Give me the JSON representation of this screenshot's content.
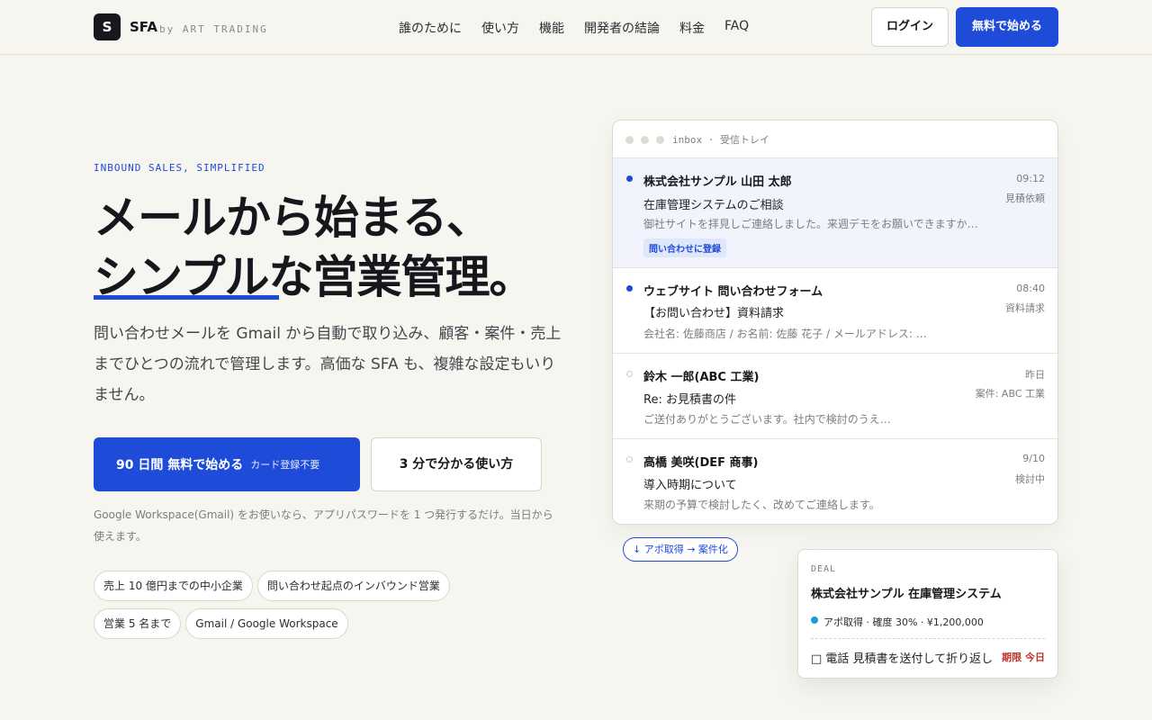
{
  "header": {
    "logo_letter": "S",
    "brand": "SFA",
    "brand_by": "by ART TRADING",
    "nav": [
      "誰のために",
      "使い方",
      "機能",
      "開発者の結論",
      "料金",
      "FAQ"
    ],
    "login_label": "ログイン",
    "start_label": "無料で始める"
  },
  "hero": {
    "eyebrow": "INBOUND SALES, SIMPLIFIED",
    "title_line1": "メールから始まる、",
    "title_line2": "シンプルな営業管理。",
    "lede": "問い合わせメールを Gmail から自動で取り込み、顧客・案件・売上までひとつの流れで管理します。高価な SFA も、複雑な設定もいりません。",
    "cta_primary": "90 日間 無料で始める",
    "cta_primary_sub": "カード登録不要",
    "cta_secondary": "3 分で分かる使い方",
    "note": "Google Workspace(Gmail) をお使いなら、アプリパスワードを 1 つ発行するだけ。当日から使えます。",
    "chips": [
      "売上 10 億円までの中小企業",
      "問い合わせ起点のインバウンド営業",
      "営業 5 名まで",
      "Gmail / Google Workspace"
    ]
  },
  "inbox": {
    "title": "inbox · 受信トレイ",
    "mails": [
      {
        "from": "株式会社サンプル 山田 太郎",
        "subject": "在庫管理システムのご相談",
        "preview": "御社サイトを拝見しご連絡しました。来週デモをお願いできますか…",
        "time": "09:12",
        "tag": "見積依頼",
        "badge": "問い合わせに登録",
        "unread": true
      },
      {
        "from": "ウェブサイト 問い合わせフォーム",
        "subject": "【お問い合わせ】資料請求",
        "preview": "会社名: 佐藤商店 / お名前: 佐藤 花子 / メールアドレス: …",
        "time": "08:40",
        "tag": "資料請求",
        "unread": true
      },
      {
        "from": "鈴木 一郎(ABC 工業)",
        "subject": "Re: お見積書の件",
        "preview": "ご送付ありがとうございます。社内で検討のうえ…",
        "time": "昨日",
        "tag": "案件: ABC 工業",
        "unread": false
      },
      {
        "from": "高橋 美咲(DEF 商事)",
        "subject": "導入時期について",
        "preview": "来期の予算で検討したく、改めてご連絡します。",
        "time": "9/10",
        "tag": "検討中",
        "unread": false
      }
    ]
  },
  "flow": "↓ アポ取得 → 案件化",
  "deal": {
    "label": "DEAL",
    "name": "株式会社サンプル 在庫管理システム",
    "status": "アポ取得 · 確度 30% · ¥1,200,000",
    "task": "□ 電話 見積書を送付して折り返し",
    "due": "期限 今日"
  }
}
